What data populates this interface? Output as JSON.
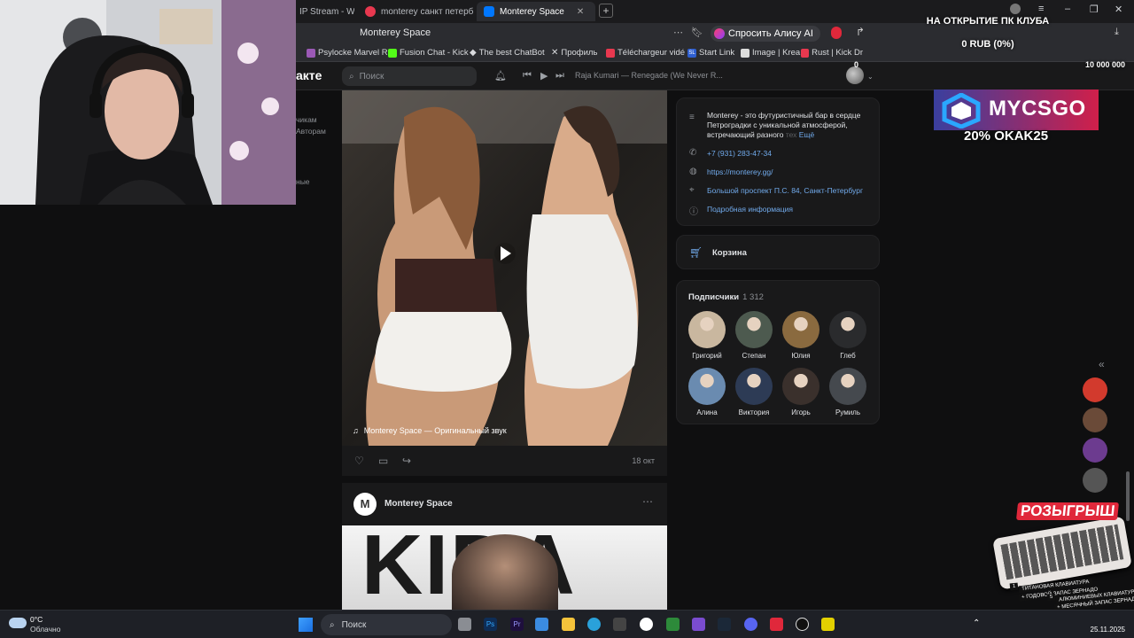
{
  "browser": {
    "tabs": [
      {
        "label": "IP Stream - Wat",
        "active": false,
        "favicon_color": "#3a3b3f"
      },
      {
        "label": "monterey санкт петербург",
        "active": false,
        "favicon_color": "#e8384f"
      },
      {
        "label": "Monterey Space",
        "active": true,
        "favicon_color": "#0077ff"
      }
    ],
    "new_tab": "+",
    "address_title": "Monterey Space",
    "alisa_button": "Спросить Алису AI",
    "bookmarks": [
      {
        "label": "Psylocke Marvel R",
        "color": "#9b59b6"
      },
      {
        "label": "Fusion Chat - Kick",
        "color": "#53fc18"
      },
      {
        "label": "The best ChatBot",
        "color": "#ffffff"
      },
      {
        "label": "Профиль",
        "color": "#ffffff"
      },
      {
        "label": "Téléchargeur vidé",
        "color": "#e8384f"
      },
      {
        "label": "Start Link",
        "color": "#2f5fd0"
      },
      {
        "label": "Image | Krea",
        "color": "#dddddd"
      },
      {
        "label": "Rust | Kick Dr",
        "color": "#e8384f"
      }
    ],
    "bookmark_prefixes": [
      "SL"
    ]
  },
  "vk": {
    "logo_text": "акте",
    "search_placeholder": "Поиск",
    "now_playing": "Raja Kumari — Renegade (We Never R...",
    "left_menu": [
      "чикам",
      "Авторам",
      "ные"
    ]
  },
  "post": {
    "audio_label": "Monterey Space — Оригинальный звук",
    "date": "18 окт"
  },
  "post2": {
    "author": "Monterey Space",
    "logo_letter": "M",
    "image_text": "KIDA"
  },
  "info_card": {
    "description": "Monterey - это футуристичный бар в сердце Петроградки с уникальной атмосферой, встречающий разного",
    "description_fade": "тех",
    "more": "Ещё",
    "phone": "+7 (931) 283-47-34",
    "website": "https://monterey.gg/",
    "address": "Большой проспект П.С. 84, Санкт-Петербург",
    "details": "Подробная информация"
  },
  "cart": {
    "label": "Корзина"
  },
  "subscribers": {
    "title": "Подписчики",
    "count": "1 312",
    "people": [
      {
        "name": "Григорий",
        "color": "#c9b79f"
      },
      {
        "name": "Степан",
        "color": "#4d5a4f"
      },
      {
        "name": "Юлия",
        "color": "#8a6a3f"
      },
      {
        "name": "Глеб",
        "color": "#2a2b2d"
      },
      {
        "name": "Алина",
        "color": "#6a8bb0"
      },
      {
        "name": "Виктория",
        "color": "#2d3b55"
      },
      {
        "name": "Игорь",
        "color": "#3a302c"
      },
      {
        "name": "Румиль",
        "color": "#45494e"
      }
    ]
  },
  "stream_overlay": {
    "club": "НА ОТКРЫТИЕ ПК КЛУБА",
    "progress": "0 RUB (0%)",
    "progress_fraction": 0,
    "goal_start": "0",
    "goal": "10 000 000",
    "brand": "MYCSGO",
    "promo": "20% OKAK25",
    "giveaway": "РОЗЫГРЫШ",
    "giveaway_line1": "ТИТАНОВАЯ КЛАВИАТУРА",
    "giveaway_line2": "+ ГОДОВОЙ ЗАПАС ЗЕРНАДО",
    "giveaway_line3": "АЛЮМИНИЕВЫХ КЛАВИАТУР",
    "giveaway_line4": "+ МЕСЯЧНЫЙ ЗАПАС ЗЕРНАДО",
    "giveaway_num1": "1",
    "giveaway_num2": "5",
    "collapse": "«"
  },
  "taskbar": {
    "temperature": "0°C",
    "weather": "Облачно",
    "search": "Поиск",
    "date": "25.11.2025",
    "ps_label": "Ps",
    "pr_label": "Pr"
  },
  "colors": {
    "accent": "#0077ff",
    "link": "#71aaeb",
    "vk_bg": "#19191a",
    "page_bg": "#0f0f10"
  }
}
